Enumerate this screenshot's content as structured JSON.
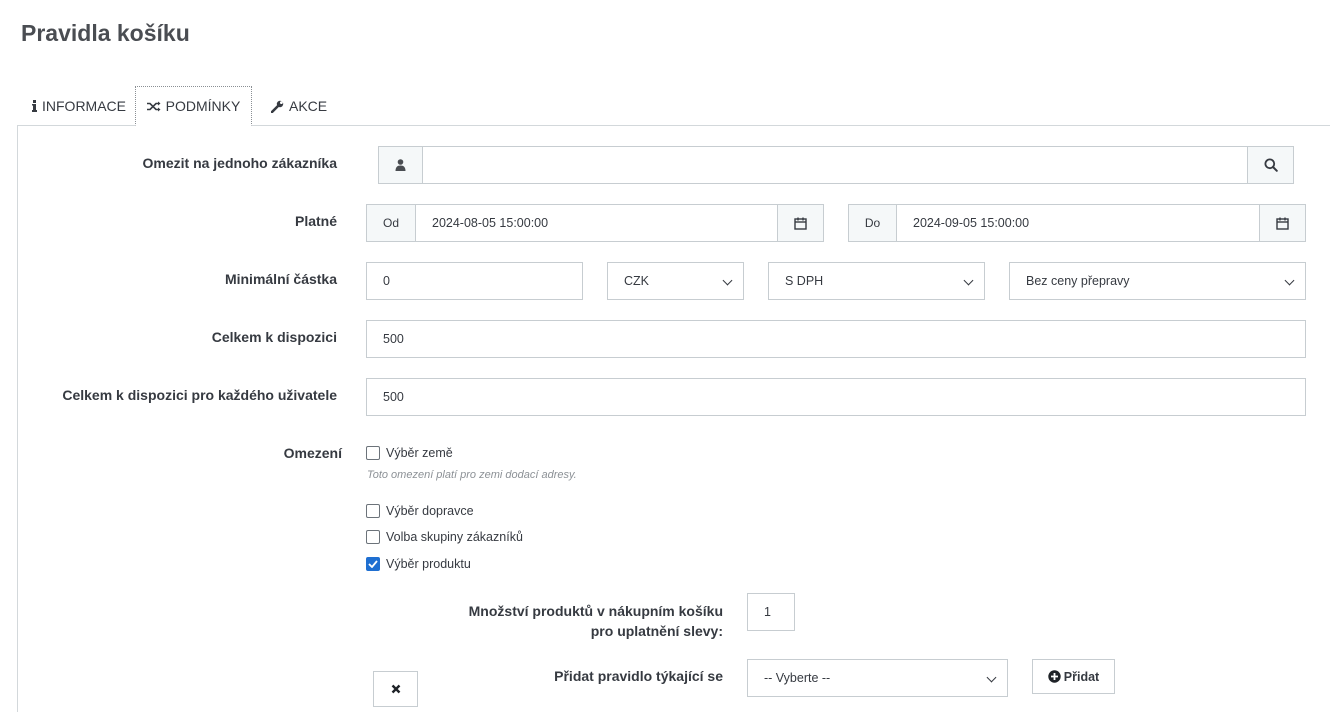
{
  "page": {
    "title": "Pravidla košíku"
  },
  "tabs": [
    {
      "label": "INFORMACE",
      "icon": "info-icon"
    },
    {
      "label": "PODMÍNKY",
      "icon": "shuffle-icon",
      "active": true
    },
    {
      "label": "AKCE",
      "icon": "wrench-icon"
    }
  ],
  "form": {
    "customer": {
      "label": "Omezit na jednoho zákazníka",
      "value": ""
    },
    "valid": {
      "label": "Platné",
      "from_label": "Od",
      "from_value": "2024-08-05 15:00:00",
      "to_label": "Do",
      "to_value": "2024-09-05 15:00:00"
    },
    "min_amount": {
      "label": "Minimální částka",
      "value": "0",
      "currency": "CZK",
      "tax": "S DPH",
      "shipping": "Bez ceny přepravy"
    },
    "total_available": {
      "label": "Celkem k dispozici",
      "value": "500"
    },
    "total_per_user": {
      "label": "Celkem k dispozici pro každého uživatele",
      "value": "500"
    },
    "restrictions": {
      "label": "Omezení",
      "country": {
        "label": "Výběr země",
        "checked": false
      },
      "country_help": "Toto omezení platí pro zemi dodací adresy.",
      "carrier": {
        "label": "Výběr dopravce",
        "checked": false
      },
      "group": {
        "label": "Volba skupiny zákazníků",
        "checked": false
      },
      "product": {
        "label": "Výběr produktu",
        "checked": true
      }
    },
    "product_rule": {
      "qty_label_1": "Množství produktů v nákupním košíku",
      "qty_label_2": "pro uplatnění slevy:",
      "qty_value": "1",
      "add_rule_label": "Přidat pravidlo týkající se",
      "select_value": "-- Vyberte --",
      "add_button": "Přidat"
    }
  },
  "colors": {
    "accent": "#1f6fd1",
    "border": "#c7cdd1",
    "addon_bg": "#f5f8f9"
  }
}
